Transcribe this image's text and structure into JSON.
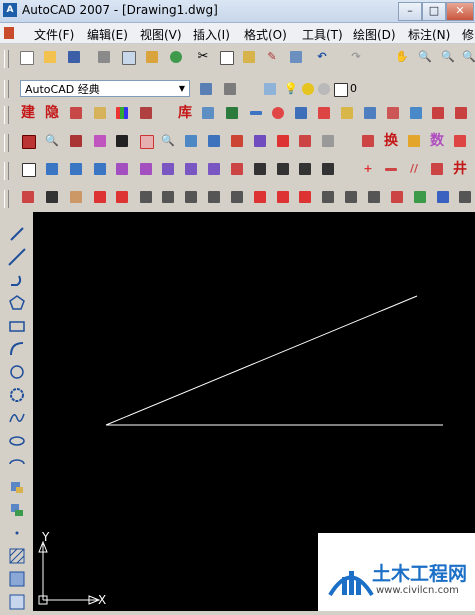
{
  "window": {
    "title": "AutoCAD 2007 - [Drawing1.dwg]",
    "app_icon": "acad-icon"
  },
  "menu": [
    "文件(F)",
    "编辑(E)",
    "视图(V)",
    "插入(I)",
    "格式(O)",
    "工具(T)",
    "绘图(D)",
    "标注(N)",
    "修"
  ],
  "workspace": {
    "value": "AutoCAD 经典"
  },
  "layer": {
    "value": "0"
  },
  "toolbar_labels": {
    "jian": "建",
    "yin": "隐",
    "ku": "库",
    "huan": "换",
    "shu": "数",
    "jing": "井"
  },
  "watermark": {
    "title": "土木工程网",
    "url": "www.civilcn.com"
  },
  "ucs": {
    "x_label": "X",
    "y_label": "Y"
  }
}
